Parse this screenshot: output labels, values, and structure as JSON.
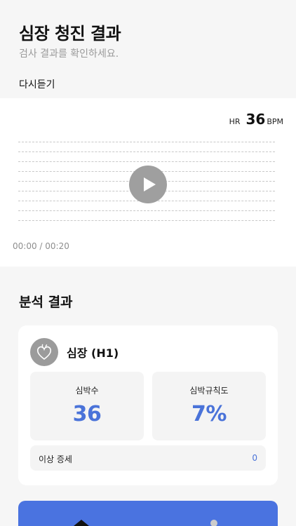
{
  "header": {
    "title": "심장 청진 결과",
    "subtitle": "검사 결과를 확인하세요.",
    "relisten_label": "다시듣기"
  },
  "player": {
    "hr_label": "HR",
    "hr_value": "36",
    "hr_unit": "BPM",
    "time": "00:00 / 00:20",
    "play_icon": "play-icon"
  },
  "analysis": {
    "title": "분석 결과",
    "organ": "심장 (H1)",
    "organ_icon": "heart-icon",
    "heart_rate_label": "심박수",
    "heart_rate_value": "36",
    "regularity_label": "심박규칙도",
    "regularity_value": "7%",
    "anomaly_label": "이상 증세",
    "anomaly_count": "0"
  },
  "colors": {
    "accent": "#4a73d9",
    "button": "#4a73e0",
    "icon_bg": "#9b9b9b"
  }
}
